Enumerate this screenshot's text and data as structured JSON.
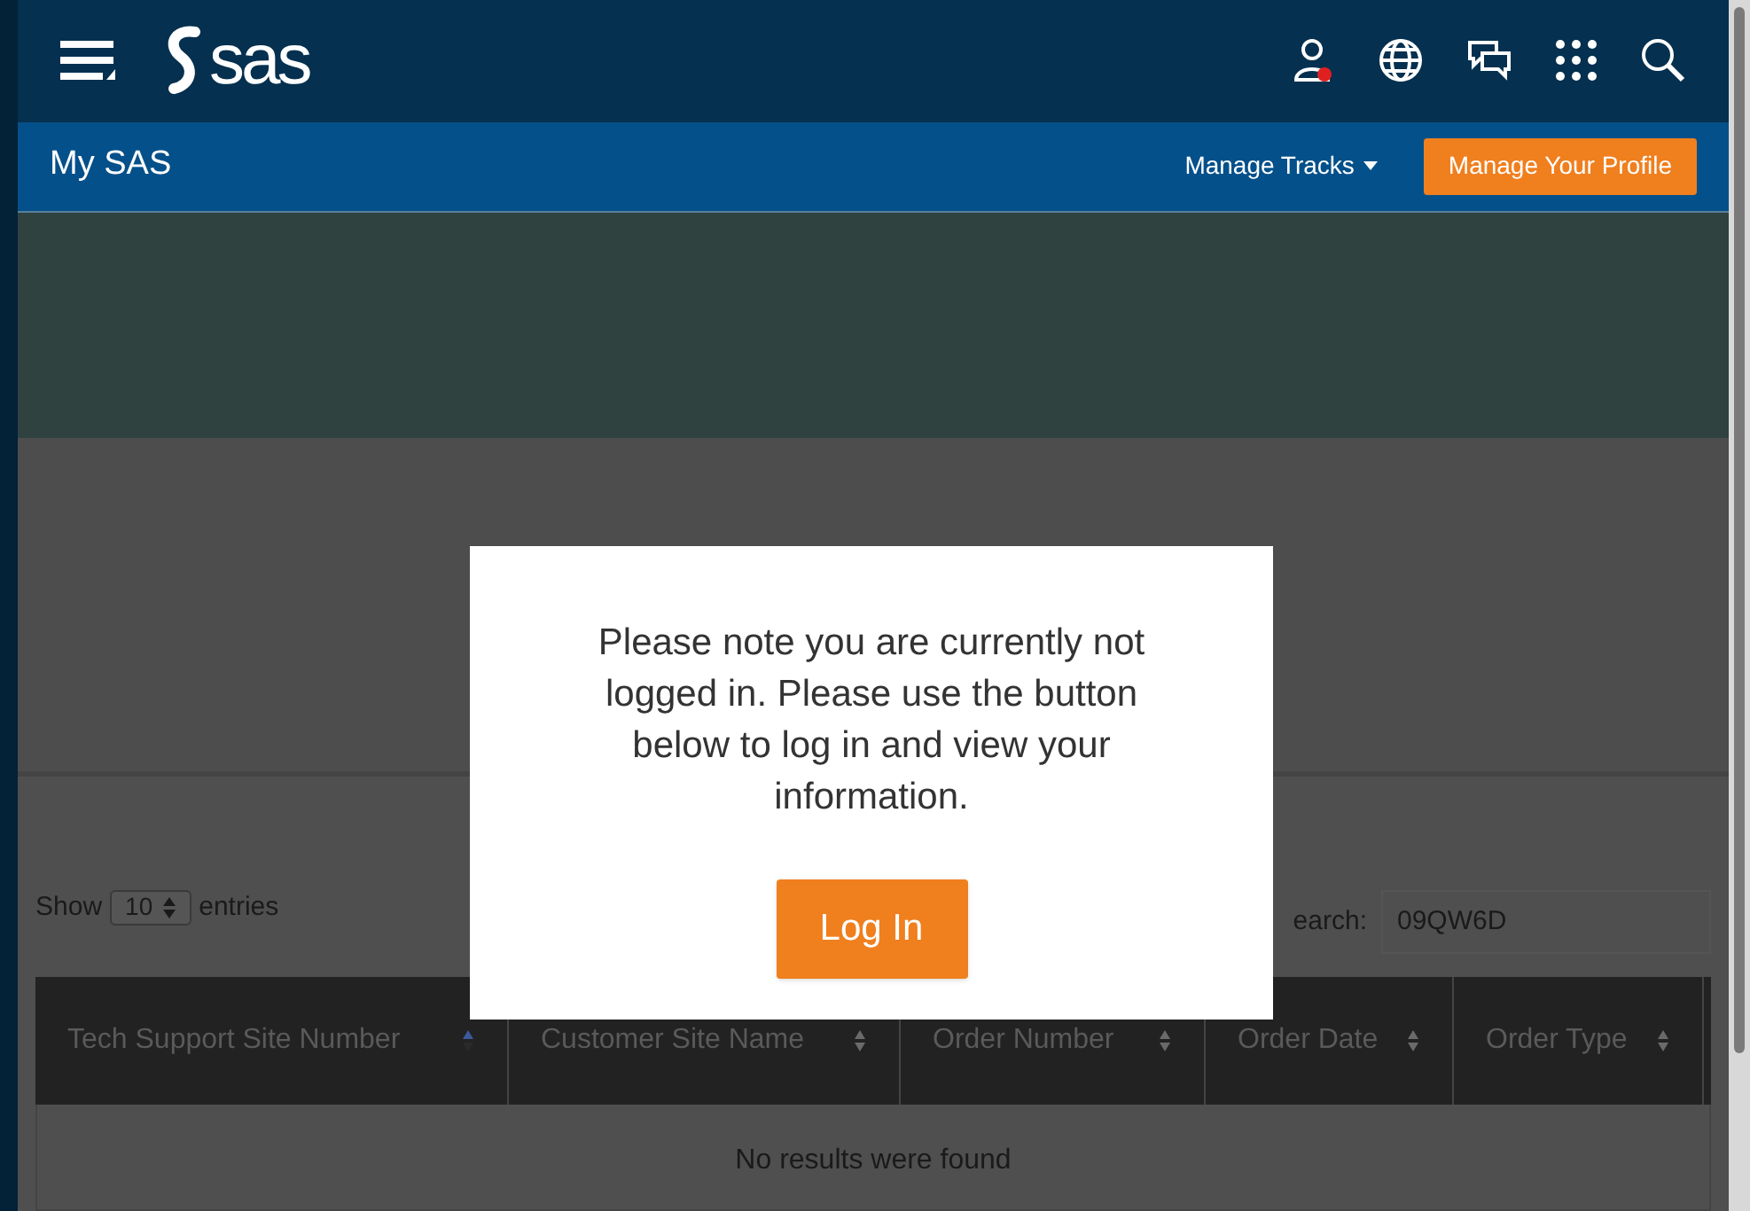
{
  "header": {
    "logo_text": "sas"
  },
  "nav_bar": {
    "title": "My SAS",
    "menu": "Manage Tracks",
    "button": "Manage Your Profile"
  },
  "modal": {
    "message": "Please note you are currently not logged in. Please use the button below to log in and view your information.",
    "button": "Log In"
  },
  "table_controls": {
    "show_label": "Show",
    "page_size": "10",
    "entries_label": "entries",
    "search_label": "earch:",
    "search_value": "09QW6D"
  },
  "table": {
    "columns": [
      {
        "label": "Tech Support Site Number",
        "sorted": true
      },
      {
        "label": "Customer Site Name",
        "sorted": false
      },
      {
        "label": "Order Number",
        "sorted": false
      },
      {
        "label": "Order Date",
        "sorted": false
      },
      {
        "label": "Order Type",
        "sorted": false
      }
    ],
    "empty_message": "No results were found"
  }
}
